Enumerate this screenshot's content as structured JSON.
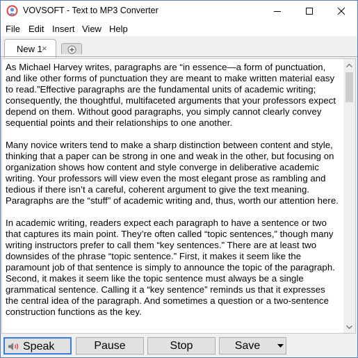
{
  "window": {
    "title": "VOVSOFT - Text to MP3 Converter",
    "icon": "app-logo-icon",
    "controls": [
      "minimize-icon",
      "maximize-icon",
      "close-icon"
    ]
  },
  "menu": [
    "File",
    "Edit",
    "Insert",
    "View",
    "Help"
  ],
  "tabs": {
    "active_label": "New 1",
    "close_glyph": "×",
    "new_tab_icon": "plus-icon"
  },
  "editor": {
    "paragraphs": [
      "As Michael Harvey writes, paragraphs are “in essence—a form of punctuation, and like other forms of punctuation they are meant to make written material easy to read.”Effective paragraphs are the fundamental units of academic writing; consequently, the thoughtful, multifaceted arguments that your professors expect depend on them. Without good paragraphs, you simply cannot clearly convey sequential points and their relationships to one another.",
      "Many novice writers tend to make a sharp distinction between content and style, thinking that a paper can be strong in one and weak in the other, but focusing on organization shows how content and style converge in deliberative academic writing. Your professors will view even the most elegant prose as rambling and tedious if there isn’t a careful, coherent argument to give the text meaning. Paragraphs are the “stuff” of academic writing and, thus, worth our attention here.",
      "In academic writing, readers expect each paragraph to have a sentence or two that captures its main point. They’re often called “topic sentences,” though many writing instructors  prefer to call them “key sentences.” There are at least two downsides of the phrase “topic sentence.” First, it makes it seem like the paramount job of that sentence is simply to announce the topic of the paragraph. Second, it makes it seem like the topic sentence must always be a single grammatical sentence. Calling it a “key sentence” reminds us that it expresses the central idea of the paragraph. And sometimes a question or a two-sentence construction functions as the key."
    ]
  },
  "buttons": {
    "speak": "Speak",
    "pause": "Pause",
    "stop": "Stop",
    "save": "Save",
    "speak_icon": "speaker-icon",
    "save_dropdown_icon": "dropdown-arrow-icon"
  }
}
